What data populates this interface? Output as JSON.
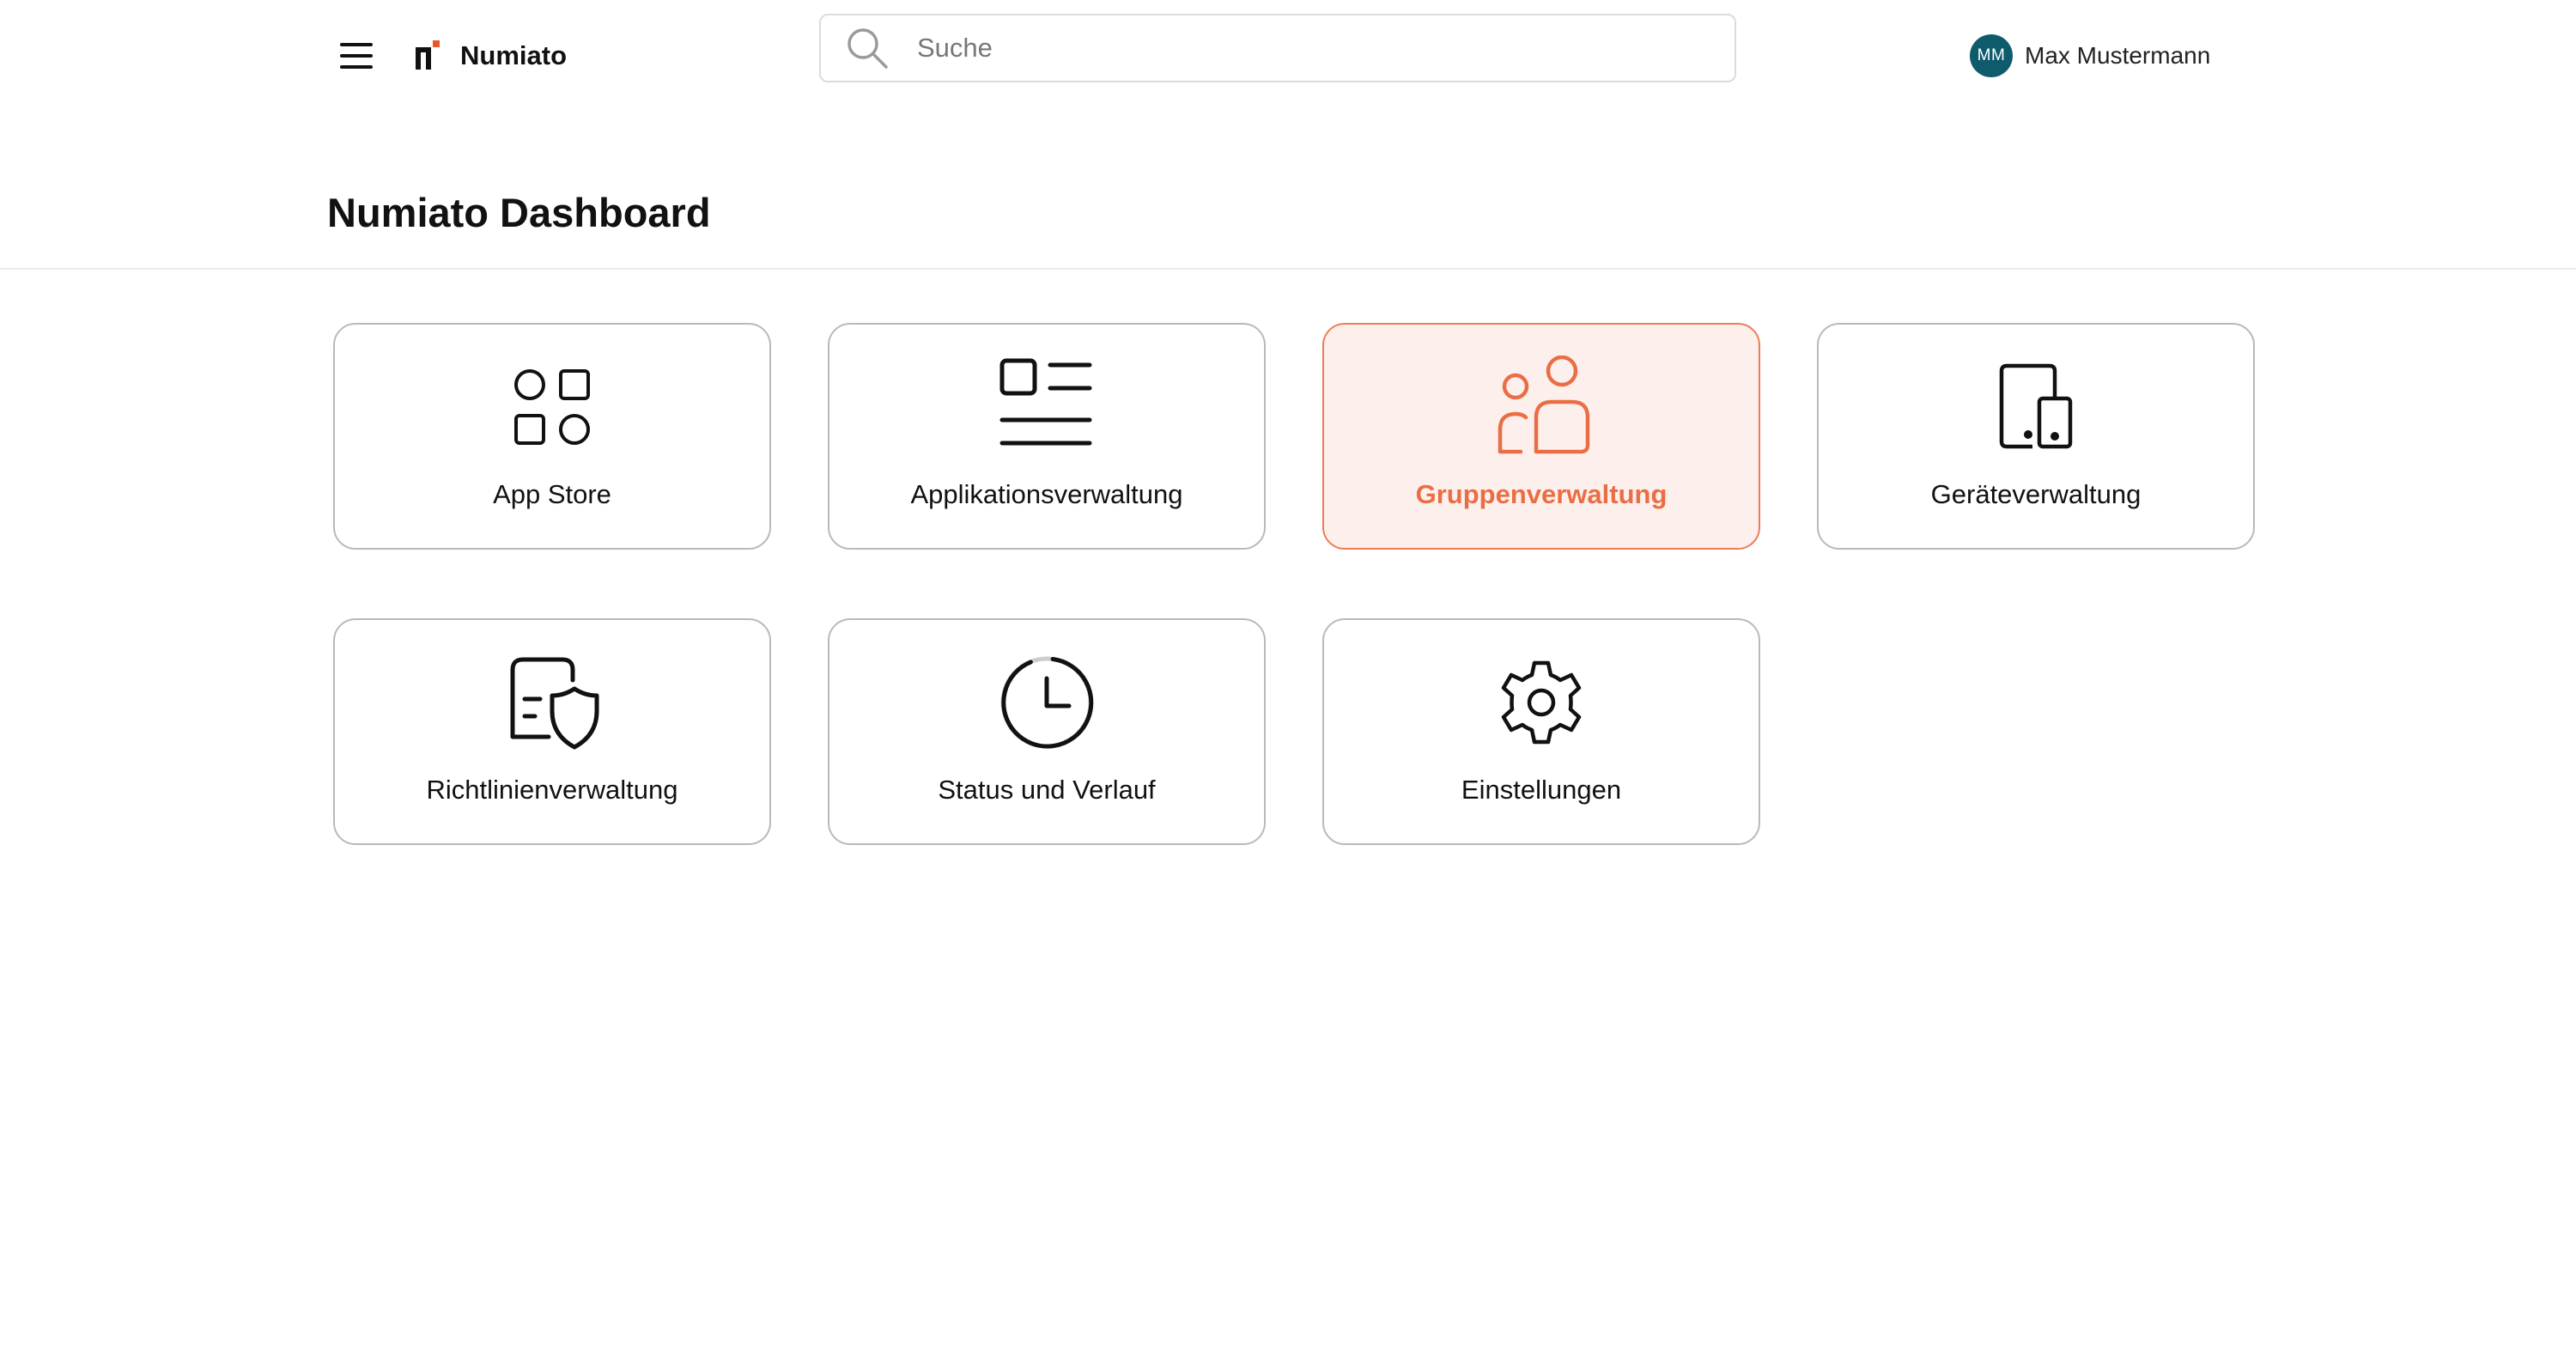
{
  "header": {
    "menu_icon": "hamburger-menu-icon",
    "logo_icon": "numiato-logo-icon",
    "brand": "Numiato",
    "search": {
      "placeholder": "Suche",
      "value": ""
    },
    "user": {
      "initials": "MM",
      "name": "Max Mustermann",
      "avatar_color": "#0d5b6b"
    }
  },
  "page": {
    "title": "Numiato Dashboard"
  },
  "tiles": [
    {
      "label": "App Store",
      "icon": "apps-grid-icon",
      "active": false
    },
    {
      "label": "Applikationsverwaltung",
      "icon": "list-icon",
      "active": false
    },
    {
      "label": "Gruppenverwaltung",
      "icon": "people-icon",
      "active": true
    },
    {
      "label": "Geräteverwaltung",
      "icon": "devices-icon",
      "active": false
    },
    {
      "label": "Richtlinienverwaltung",
      "icon": "policy-shield-icon",
      "active": false
    },
    {
      "label": "Status und Verlauf",
      "icon": "clock-history-icon",
      "active": false
    },
    {
      "label": "Einstellungen",
      "icon": "gear-icon",
      "active": false
    }
  ],
  "colors": {
    "accent": "#ea6e45",
    "active_tile_bg": "#fdf0ec",
    "tile_border": "#b9b9b9",
    "logo_accent": "#e8552b"
  }
}
